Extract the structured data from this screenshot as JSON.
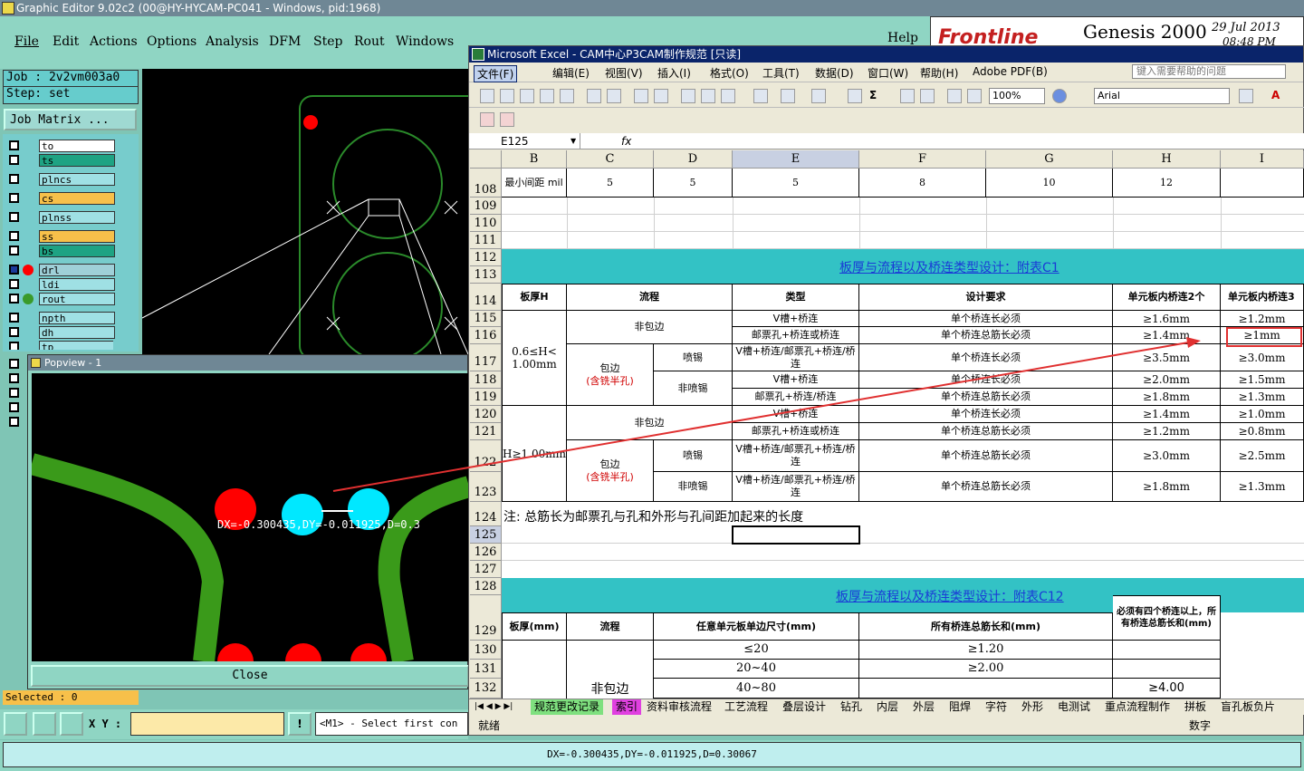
{
  "genesis": {
    "title": "Graphic Editor 9.02c2 (00@HY-HYCAM-PC041 - Windows, pid:1968)",
    "menu": [
      "File",
      "Edit",
      "Actions",
      "Options",
      "Analysis",
      "DFM",
      "Step",
      "Rout",
      "Windows"
    ],
    "help": "Help",
    "brand": "Frontline",
    "product": "Genesis 2000",
    "date": "29 Jul 2013",
    "time": "08:48 PM",
    "job": "Job : 2v2vm003a0",
    "step": "Step: set",
    "job_matrix": "Job Matrix ...",
    "layers": [
      {
        "name": "to",
        "color": "#ffffff"
      },
      {
        "name": "ts",
        "color": "#1ea383"
      },
      {
        "name": "plncs",
        "color": "#9fe0e4"
      },
      {
        "name": "cs",
        "color": "#f7c04a"
      },
      {
        "name": "plnss",
        "color": "#9fe0e4"
      },
      {
        "name": "ss",
        "color": "#f7c04a"
      },
      {
        "name": "bs",
        "color": "#1ea383"
      },
      {
        "name": "drl",
        "color": "#9fd0d8"
      },
      {
        "name": "ldi",
        "color": "#9fe0e4"
      },
      {
        "name": "rout",
        "color": "#9fe0e4"
      },
      {
        "name": "npth",
        "color": "#9fe0e4"
      },
      {
        "name": "dh",
        "color": "#9fe0e4"
      },
      {
        "name": "tp",
        "color": "#9fe0e4"
      }
    ],
    "popview_title": "Popview - 1",
    "measure_overlay": "DX=-0.300435,DY=-0.011925,D=0.3",
    "close_label": "Close",
    "selected": "Selected : 0",
    "xy_label": "X Y :",
    "message": "<M1> - Select first con",
    "status": "DX=-0.300435,DY=-0.011925,D=0.30067"
  },
  "excel": {
    "title": "Microsoft Excel - CAM中心P3CAM制作规范 [只读]",
    "menu": [
      "文件(F)",
      "编辑(E)",
      "视图(V)",
      "插入(I)",
      "格式(O)",
      "工具(T)",
      "数据(D)",
      "窗口(W)",
      "帮助(H)",
      "Adobe PDF(B)"
    ],
    "help_placeholder": "键入需要帮助的问题",
    "zoom": "100%",
    "font": "Arial",
    "name_box": "E125",
    "fx": "fx",
    "columns": [
      "B",
      "C",
      "D",
      "E",
      "F",
      "G",
      "H",
      "I"
    ],
    "rows": [
      "108",
      "109",
      "110",
      "111",
      "112",
      "113",
      "114",
      "115",
      "116",
      "117",
      "118",
      "119",
      "120",
      "121",
      "122",
      "123",
      "124",
      "125",
      "126",
      "127",
      "128",
      "129",
      "130",
      "131",
      "132"
    ],
    "r108": {
      "label": "最小间距 mil",
      "c": "5",
      "d": "5",
      "e": "5",
      "f": "8",
      "g": "10",
      "h": "12"
    },
    "table1": {
      "title": "板厚与流程以及桥连类型设计：附表C1",
      "headers": [
        "板厚H",
        "流程",
        "类型",
        "设计要求",
        "单元板内桥连2个",
        "单元板内桥连3"
      ],
      "thick1": "0.6≤H< 1.00mm",
      "thick2": "H≥1.00mm",
      "flow_non": "非包边",
      "flow_wrap": "包边",
      "flow_wrap_note": "(含铣半孔)",
      "spray": "喷锡",
      "nospray": "非喷锡",
      "types": [
        "V槽+桥连",
        "邮票孔+桥连或桥连",
        "V槽+桥连/邮票孔+桥连/桥连",
        "V槽+桥连",
        "邮票孔+桥连/桥连",
        "V槽+桥连",
        "邮票孔+桥连或桥连",
        "V槽+桥连/邮票孔+桥连/桥连",
        "V槽+桥连/邮票孔+桥连/桥连"
      ],
      "reqs": [
        "单个桥连长必须",
        "单个桥连总筋长必须",
        "单个桥连长必须",
        "单个桥连长必须",
        "单个桥连总筋长必须",
        "单个桥连长必须",
        "单个桥连总筋长必须",
        "单个桥连总筋长必须",
        "单个桥连总筋长必须"
      ],
      "two": [
        "≥1.6mm",
        "≥1.4mm",
        "≥3.5mm",
        "≥2.0mm",
        "≥1.8mm",
        "≥1.4mm",
        "≥1.2mm",
        "≥3.0mm",
        "≥1.8mm"
      ],
      "three": [
        "≥1.2mm",
        "≥1mm",
        "≥3.0mm",
        "≥1.5mm",
        "≥1.3mm",
        "≥1.0mm",
        "≥0.8mm",
        "≥2.5mm",
        "≥1.3mm"
      ]
    },
    "note": "注: 总筋长为邮票孔与孔和外形与孔间距加起来的长度",
    "table2": {
      "title": "板厚与流程以及桥连类型设计：附表C12",
      "headers": [
        "板厚(mm)",
        "流程",
        "任意单元板单边尺寸(mm)",
        "所有桥连总筋长和(mm)",
        "必须有四个桥连以上，所有桥连总筋长和(mm)"
      ],
      "flow": "非包边",
      "sizes": [
        "≤20",
        "20~40",
        "40~80"
      ],
      "sums": [
        "≥1.20",
        "≥2.00",
        ""
      ],
      "four": [
        "",
        "",
        "≥4.00"
      ]
    },
    "sheet_tabs": [
      "规范更改记录",
      "索引",
      "资料审核流程",
      "工艺流程",
      "叠层设计",
      "钻孔",
      "内层",
      "外层",
      "阻焊",
      "字符",
      "外形",
      "电测试",
      "重点流程制作",
      "拼板",
      "盲孔板负片"
    ],
    "status_ready": "就绪",
    "status_num": "数字"
  },
  "colors": {
    "genesis_bg": "#8fd5c3",
    "teal_band": "#33c2c5",
    "link": "#1a3bd6",
    "annotation": "#e03030",
    "excel_title": "#0a246a"
  }
}
